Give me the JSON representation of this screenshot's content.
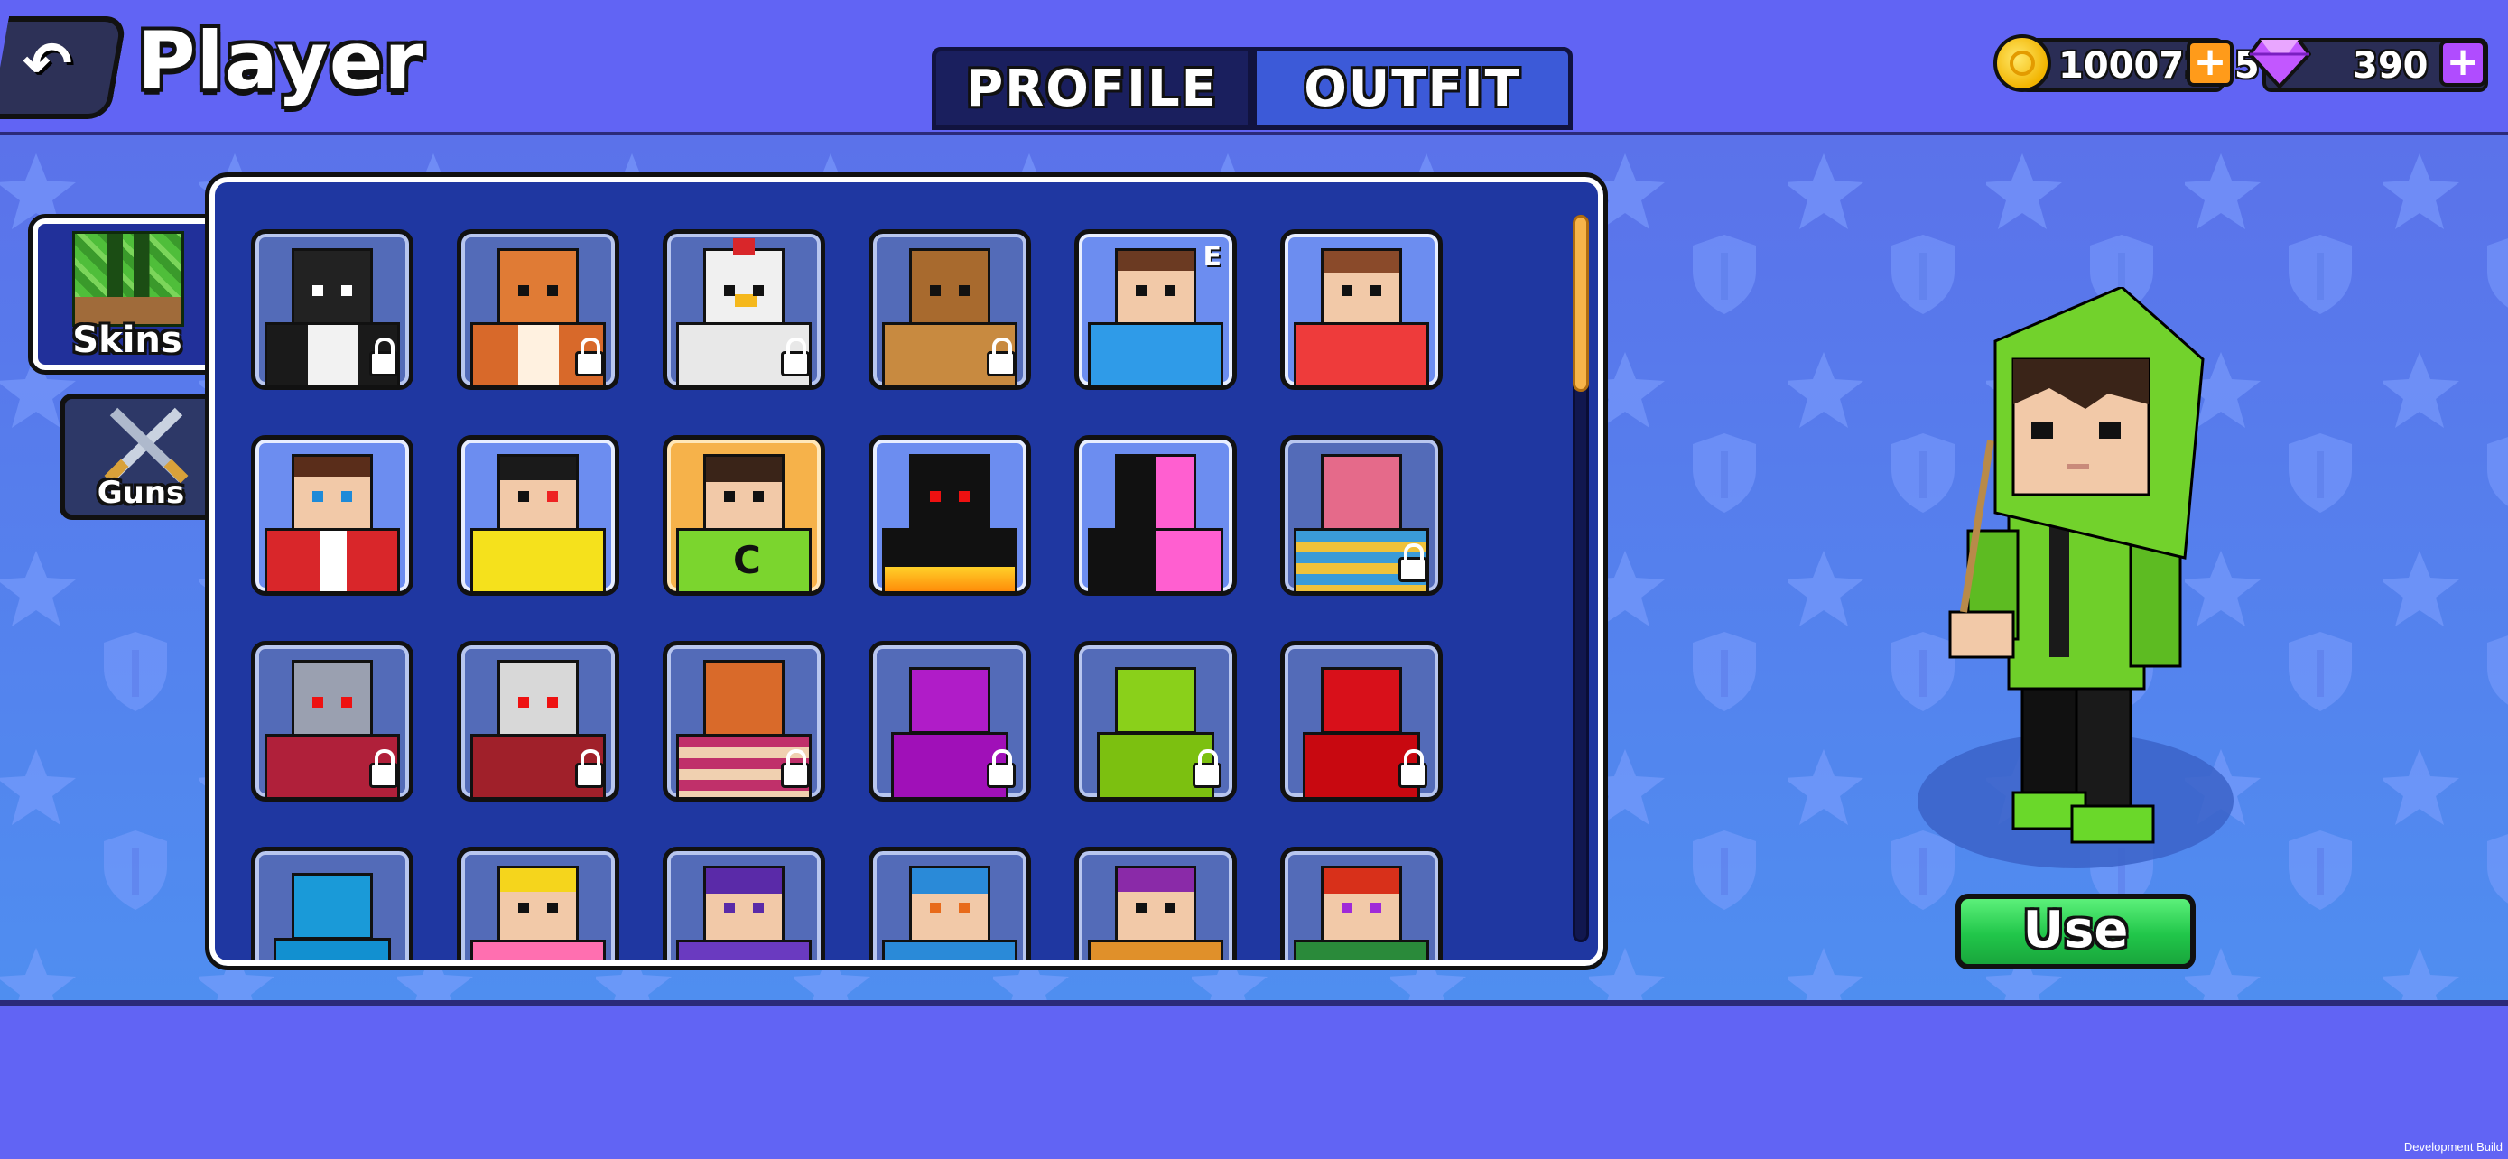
{
  "header": {
    "title": "Player",
    "tabs": [
      {
        "label": "PROFILE",
        "active": false
      },
      {
        "label": "OUTFIT",
        "active": true
      }
    ],
    "coins": "10007285",
    "gems": "390"
  },
  "side_tabs": [
    {
      "label": "Skins",
      "active": true,
      "icon": "creeper-head-icon"
    },
    {
      "label": "Guns",
      "active": false,
      "icon": "crossed-swords-icon"
    }
  ],
  "skins": [
    {
      "name": "penguin",
      "locked": true
    },
    {
      "name": "fox",
      "locked": true
    },
    {
      "name": "chicken",
      "locked": true
    },
    {
      "name": "lion",
      "locked": true
    },
    {
      "name": "boy-blue-shirt",
      "locked": false,
      "badge": "E"
    },
    {
      "name": "girl-red-shirt",
      "locked": false
    },
    {
      "name": "boy-red-jacket",
      "locked": false
    },
    {
      "name": "boy-yellow-smile",
      "locked": false
    },
    {
      "name": "green-hoodie",
      "locked": false,
      "selected": true,
      "shirt_letter": "C"
    },
    {
      "name": "black-flame",
      "locked": false
    },
    {
      "name": "pink-black",
      "locked": false
    },
    {
      "name": "toy-monster",
      "locked": true
    },
    {
      "name": "robot-king-1",
      "locked": true
    },
    {
      "name": "skeleton-king",
      "locked": true
    },
    {
      "name": "crab-king",
      "locked": true
    },
    {
      "name": "purple-block",
      "locked": true
    },
    {
      "name": "lime-block",
      "locked": true
    },
    {
      "name": "red-block",
      "locked": true
    },
    {
      "name": "blue-block",
      "locked": false
    },
    {
      "name": "pink-duck-girl",
      "locked": false
    },
    {
      "name": "purple-hair-girl",
      "locked": false
    },
    {
      "name": "blue-hair-girl",
      "locked": false
    },
    {
      "name": "purple-crown-girl",
      "locked": false
    },
    {
      "name": "red-hair-girl",
      "locked": false
    }
  ],
  "actions": {
    "use_label": "Use"
  },
  "footer": {
    "build_label": "Development Build"
  },
  "colors": {
    "background": "#6164f4",
    "panel": "#1f37a1",
    "selected_card": "#f6b24a",
    "use_button": "#21c64a",
    "active_tab": "#3c5ad8"
  }
}
